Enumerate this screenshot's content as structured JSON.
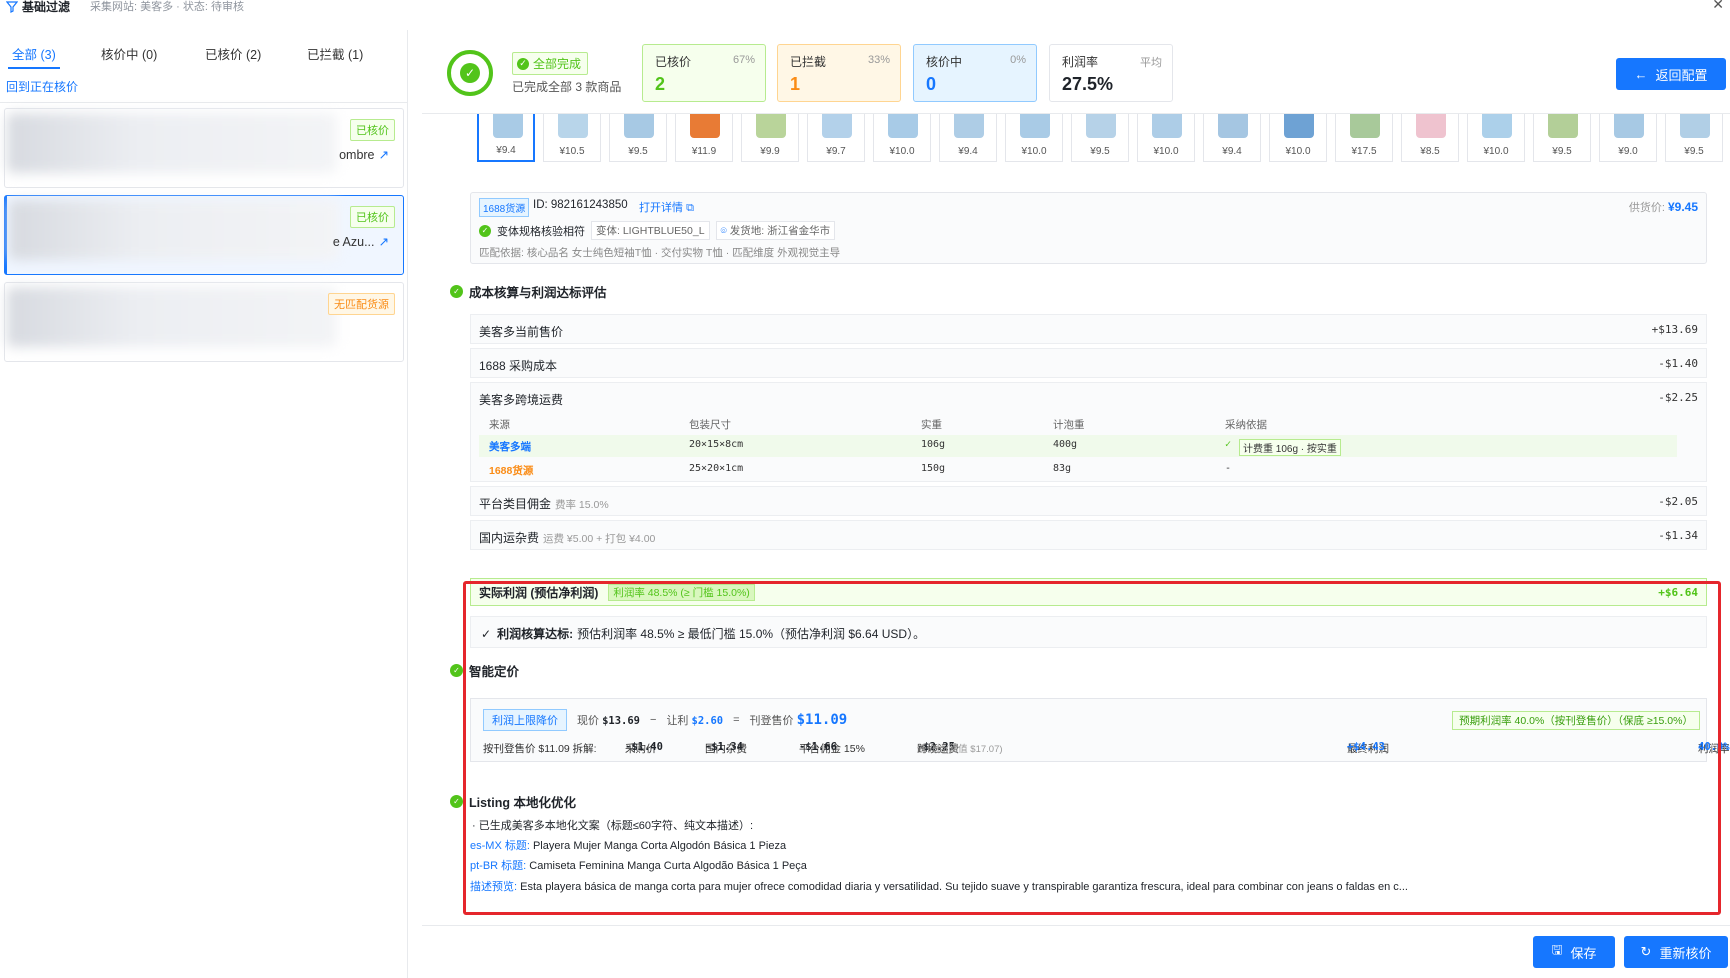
{
  "topbar": {
    "title": "基础过滤",
    "subtitle": "采集网站: 美客多 · 状态: 待审核"
  },
  "tabs": [
    {
      "label": "全部 (3)"
    },
    {
      "label": "核价中 (0)"
    },
    {
      "label": "已核价 (2)"
    },
    {
      "label": "已拦截 (1)"
    }
  ],
  "back_to_current": "回到正在核价",
  "cards": [
    {
      "badge": "已核价",
      "title": "ombre"
    },
    {
      "badge": "已核价",
      "title": "e Azu..."
    },
    {
      "badge": "无匹配货源"
    }
  ],
  "header": {
    "done_tag": "全部完成",
    "done_sub": "已完成全部 3 款商品",
    "stats": [
      {
        "label": "已核价",
        "pct": "67%",
        "value": "2"
      },
      {
        "label": "已拦截",
        "pct": "33%",
        "value": "1"
      },
      {
        "label": "核价中",
        "pct": "0%",
        "value": "0"
      },
      {
        "label": "利润率",
        "pct": "平均",
        "value": "27.5%"
      }
    ],
    "back_button": "返回配置"
  },
  "thumbnails": [
    {
      "price": "¥9.4",
      "color": "#a9cbe6"
    },
    {
      "price": "¥10.5",
      "color": "#b8d5ea"
    },
    {
      "price": "¥9.5",
      "color": "#a7c9e4"
    },
    {
      "price": "¥11.9",
      "color": "#e87b35"
    },
    {
      "price": "¥9.9",
      "color": "#b9d49a"
    },
    {
      "price": "¥9.7",
      "color": "#b3d1ea"
    },
    {
      "price": "¥10.0",
      "color": "#a8cbe7"
    },
    {
      "price": "¥9.4",
      "color": "#aecde6"
    },
    {
      "price": "¥10.0",
      "color": "#a9cbe6"
    },
    {
      "price": "¥9.5",
      "color": "#b6d2e8"
    },
    {
      "price": "¥10.0",
      "color": "#adcde7"
    },
    {
      "price": "¥9.4",
      "color": "#a5c6e2"
    },
    {
      "price": "¥10.0",
      "color": "#6ea2d4"
    },
    {
      "price": "¥17.5",
      "color": "#a8c99a"
    },
    {
      "price": "¥8.5",
      "color": "#efc3cf"
    },
    {
      "price": "¥10.0",
      "color": "#acd0ea"
    },
    {
      "price": "¥9.5",
      "color": "#b3cf98"
    },
    {
      "price": "¥9.0",
      "color": "#a7c9e4"
    },
    {
      "price": "¥9.5",
      "color": "#b1cfe6"
    }
  ],
  "source": {
    "tag": "1688货源",
    "id_text": "ID: 982161243850",
    "open_link": "打开详情",
    "price_label": "供货价:",
    "price_value": "¥9.45",
    "match_text": "变体规格核验相符",
    "variant": "变体: LIGHTBLUE50_L",
    "location": "发货地: 浙江省金华市",
    "basis": "匹配依据: 核心品名 女士纯色短袖T恤 · 交付实物 T恤 · 匹配维度 外观视觉主导"
  },
  "cost_section": {
    "title": "成本核算与利润达标评估",
    "rows": [
      {
        "label": "美客多当前售价",
        "value": "+$13.69"
      },
      {
        "label": "1688 采购成本",
        "value": "-$1.40"
      },
      {
        "label": "美客多跨境运费",
        "value": "-$2.25"
      },
      {
        "label": "平台类目佣金",
        "note": "费率 15.0%",
        "value": "-$2.05"
      },
      {
        "label": "国内运杂费",
        "note": "运费 ¥5.00 + 打包 ¥4.00",
        "value": "-$1.34"
      }
    ],
    "ship_headers": [
      "来源",
      "包装尺寸",
      "实重",
      "计泡重",
      "采纳依据"
    ],
    "ship_rows": [
      {
        "source": "美客多端",
        "size": "20×15×8cm",
        "weight": "106g",
        "vol": "400g",
        "basis": "计费重 106g · 按实重"
      },
      {
        "source": "1688货源",
        "size": "25×20×1cm",
        "weight": "150g",
        "vol": "83g",
        "basis": "-"
      }
    ],
    "profit_label": "实际利润 (预估净利润)",
    "profit_rate": "利润率 48.5% (≥ 门槛 15.0%)",
    "profit_value": "+$6.64",
    "pass_title": "利润核算达标:",
    "pass_text": "预估利润率 48.5% ≥ 最低门槛 15.0%（预估净利润 $6.64 USD）。"
  },
  "pricing": {
    "title": "智能定价",
    "tag": "利润上限降价",
    "now_label": "现价",
    "now_value": "$13.69",
    "minus": "−",
    "concede_label": "让利",
    "concede_value": "$2.60",
    "equals": "=",
    "final_label": "刊登售价",
    "final_value": "$11.09",
    "expected": "预期利润率 40.0%（按刊登售价）（保底 ≥15.0%）",
    "breakdown_label": "按刊登售价 $11.09 拆解:",
    "purchase_label": "采购价",
    "purchase_value": "-$1.40",
    "domestic_label": "国内杂费",
    "domestic_value": "-$1.34",
    "commission_label": "平台佣金 15%",
    "commission_value": "-$1.66",
    "ship_label": "跨境运费",
    "ship_value": "-$2.25",
    "ship_note": "低价档(阈值 $17.07)",
    "final_profit_label": "最终利润",
    "final_profit_value": "+$4.43",
    "rate_label": "利润率",
    "rate_value": "40.0%"
  },
  "listing": {
    "title": "Listing 本地化优化",
    "intro": "· 已生成美客多本地化文案（标题≤60字符、纯文本描述）:",
    "es_label": "es-MX 标题:",
    "es_text": "Playera Mujer Manga Corta Algodón Básica 1 Pieza",
    "pt_label": "pt-BR 标题:",
    "pt_text": "Camiseta Feminina Manga Curta Algodão Básica 1 Peça",
    "desc_label": "描述预览:",
    "desc_text": "Esta playera básica de manga corta para mujer ofrece comodidad diaria y versatilidad. Su tejido suave y transpirable garantiza frescura, ideal para combinar con jeans o faldas en c..."
  },
  "footer": {
    "save": "保存",
    "reprice": "重新核价"
  }
}
